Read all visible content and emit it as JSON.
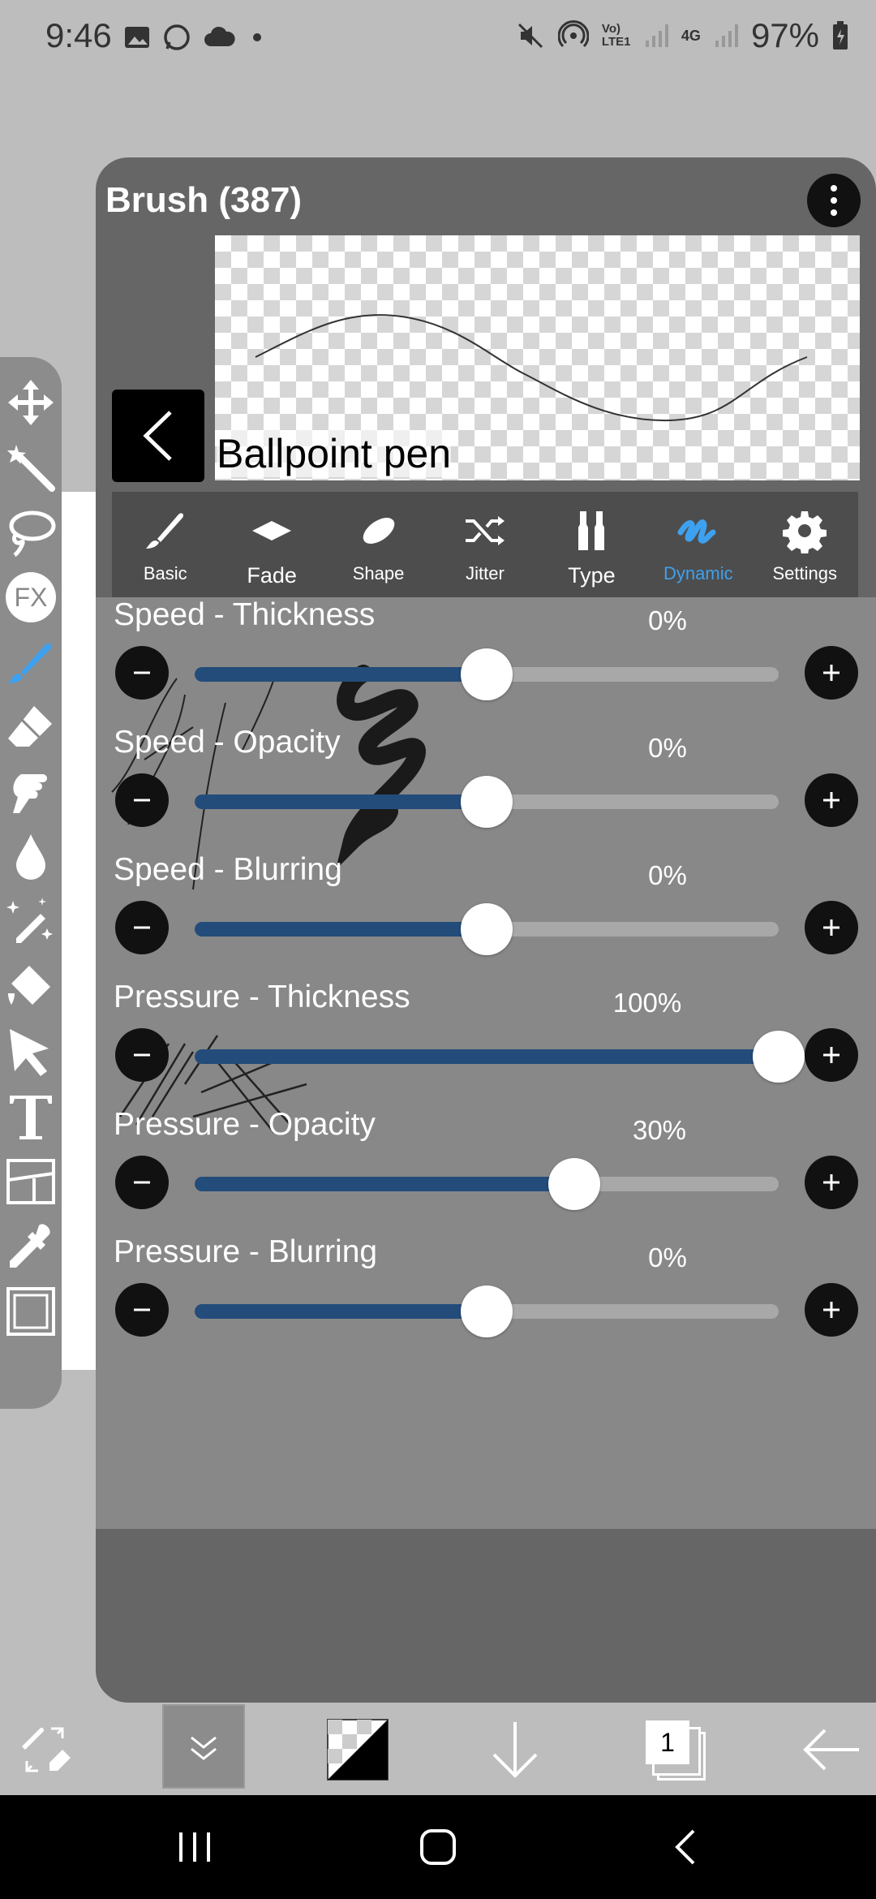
{
  "status_bar": {
    "time": "9:46",
    "network": "Vo) LTE1",
    "net_gen": "4G",
    "battery": "97%",
    "icons": [
      "gallery-icon",
      "whatsapp-icon",
      "cloud-icon",
      "dot-icon",
      "mute-icon",
      "hotspot-icon",
      "signal-icon",
      "battery-icon"
    ]
  },
  "panel": {
    "title": "Brush (387)",
    "brush_name": "Ballpoint pen"
  },
  "tabs": [
    {
      "label": "Basic",
      "icon": "brush-icon",
      "active": false
    },
    {
      "label": "Fade",
      "icon": "diamond-icon",
      "active": false
    },
    {
      "label": "Shape",
      "icon": "ellipse-icon",
      "active": false
    },
    {
      "label": "Jitter",
      "icon": "shuffle-icon",
      "active": false
    },
    {
      "label": "Type",
      "icon": "paint-tubes-icon",
      "active": false
    },
    {
      "label": "Dynamic",
      "icon": "dynamic-stroke-icon",
      "active": true
    },
    {
      "label": "Settings",
      "icon": "gear-icon",
      "active": false
    }
  ],
  "sliders": [
    {
      "label": "Speed - Thickness",
      "value_text": "0%",
      "value": 0.5
    },
    {
      "label": "Speed - Opacity",
      "value_text": "0%",
      "value": 0.5
    },
    {
      "label": "Speed - Blurring",
      "value_text": "0%",
      "value": 0.5
    },
    {
      "label": "Pressure - Thickness",
      "value_text": "100%",
      "value": 1.0
    },
    {
      "label": "Pressure - Opacity",
      "value_text": "30%",
      "value": 0.65
    },
    {
      "label": "Pressure - Blurring",
      "value_text": "0%",
      "value": 0.5
    }
  ],
  "toolbar": [
    "move-icon",
    "magic-wand-icon",
    "lasso-icon",
    "fx-icon",
    "brush-icon",
    "eraser-icon",
    "smudge-icon",
    "blur-drop-icon",
    "sparkle-brush-icon",
    "fill-icon",
    "select-arrow-icon",
    "text-icon",
    "frame-divider-icon",
    "eyedropper-icon",
    "canvas-icon"
  ],
  "fx_label": "FX",
  "bottom_bar": {
    "layer_count": "1",
    "icons": [
      "swap-brush-eraser-icon",
      "collapse-icon",
      "color-swatch-icon",
      "download-icon",
      "layers-icon",
      "back-arrow-icon"
    ]
  },
  "nav_bar": [
    "recents-icon",
    "home-icon",
    "back-icon"
  ],
  "colors": {
    "accent": "#3ea1ef",
    "fill": "#234c7a",
    "panel": "#666666",
    "tabbar": "#4d4d4d"
  }
}
